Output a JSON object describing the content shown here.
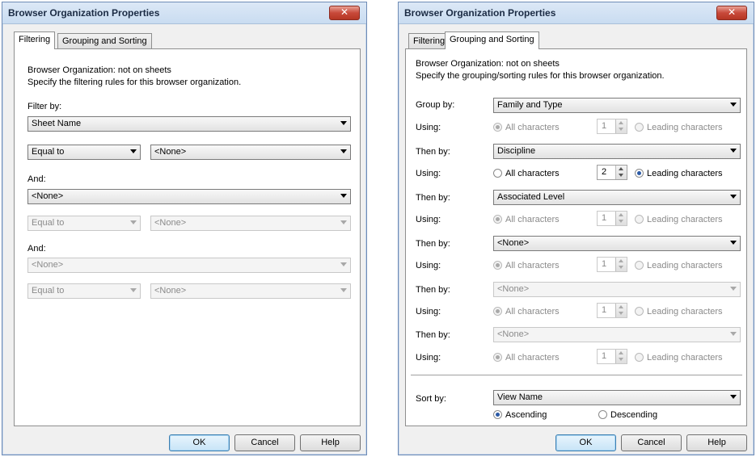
{
  "dialog1": {
    "title": "Browser Organization Properties",
    "close": "✕",
    "tabs": [
      "Filtering",
      "Grouping and Sorting"
    ],
    "heading": "Browser Organization: not on sheets",
    "description": "Specify the filtering rules for this browser organization.",
    "filter_by_label": "Filter by:",
    "filter_by_value": "Sheet Name",
    "cond1_operator": "Equal to",
    "cond1_value": "<None>",
    "and1_label": "And:",
    "and1_value": "<None>",
    "cond2_operator": "Equal to",
    "cond2_value": "<None>",
    "and2_label": "And:",
    "and2_value": "<None>",
    "cond3_operator": "Equal to",
    "cond3_value": "<None>",
    "buttons": {
      "ok": "OK",
      "cancel": "Cancel",
      "help": "Help"
    }
  },
  "dialog2": {
    "title": "Browser Organization Properties",
    "close": "✕",
    "tabs": [
      "Filtering",
      "Grouping and Sorting"
    ],
    "heading": "Browser Organization: not on sheets",
    "description": "Specify the grouping/sorting rules for this browser organization.",
    "using_label": "Using:",
    "all_chars_label": "All characters",
    "leading_chars_label": "Leading characters",
    "groups": [
      {
        "label": "Group by:",
        "value": "Family and Type",
        "count": "1"
      },
      {
        "label": "Then by:",
        "value": "Discipline",
        "count": "2"
      },
      {
        "label": "Then by:",
        "value": "Associated Level",
        "count": "1"
      },
      {
        "label": "Then by:",
        "value": "<None>",
        "count": "1"
      },
      {
        "label": "Then by:",
        "value": "<None>",
        "count": "1"
      },
      {
        "label": "Then by:",
        "value": "<None>",
        "count": "1"
      }
    ],
    "sort_by_label": "Sort by:",
    "sort_by_value": "View Name",
    "ascending_label": "Ascending",
    "descending_label": "Descending",
    "buttons": {
      "ok": "OK",
      "cancel": "Cancel",
      "help": "Help"
    }
  }
}
